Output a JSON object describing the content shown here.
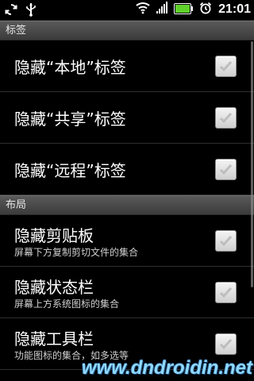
{
  "status_bar": {
    "time": "21:01",
    "icons_left": [
      "sync-icon",
      "usb-icon"
    ],
    "icons_right": [
      "wifi-icon",
      "signal-icon",
      "battery-icon",
      "alarm-icon"
    ]
  },
  "sections": [
    {
      "header": "标签",
      "items": [
        {
          "title": "隐藏“本地”标签",
          "summary": "",
          "checked": false
        },
        {
          "title": "隐藏“共享”标签",
          "summary": "",
          "checked": false
        },
        {
          "title": "隐藏“远程”标签",
          "summary": "",
          "checked": false
        }
      ]
    },
    {
      "header": "布局",
      "items": [
        {
          "title": "隐藏剪贴板",
          "summary": "屏幕下方复制剪切文件的集合",
          "checked": false
        },
        {
          "title": "隐藏状态栏",
          "summary": "屏幕上方系统图标的集合",
          "checked": false
        },
        {
          "title": "隐藏工具栏",
          "summary": "功能图标的集合，如多选等",
          "checked": false
        }
      ]
    }
  ],
  "watermark": "www.dndroidin.net"
}
